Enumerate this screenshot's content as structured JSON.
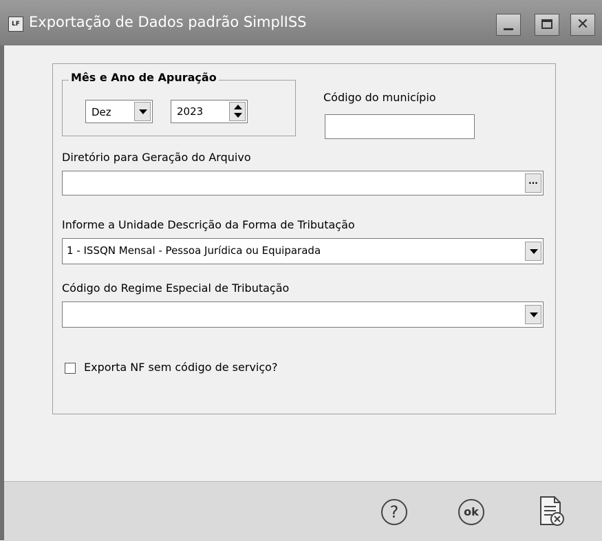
{
  "window": {
    "title": "Exportação de Dados padrão SimplISS",
    "icon_text": "LF"
  },
  "period_group": {
    "legend": "Mês e Ano de Apuração",
    "month": "Dez",
    "year": "2023"
  },
  "municipio": {
    "label": "Código do município",
    "value": ""
  },
  "diretorio": {
    "label": "Diretório para Geração do Arquivo",
    "value": "",
    "browse_label": "..."
  },
  "tributacao": {
    "label": "Informe a Unidade Descrição da Forma de Tributação",
    "selected": "1 - ISSQN Mensal - Pessoa Jurídica ou Equiparada"
  },
  "regime": {
    "label": "Código do Regime Especial de Tributação",
    "selected": ""
  },
  "export_nf": {
    "label": "Exporta NF sem código de serviço?",
    "checked": false
  },
  "footer": {
    "help_glyph": "?",
    "ok_glyph": "ok"
  },
  "colors": {
    "title_bar": "#8a8a8a",
    "client_bg": "#f0f0f0",
    "footer_bg": "#dadada"
  }
}
